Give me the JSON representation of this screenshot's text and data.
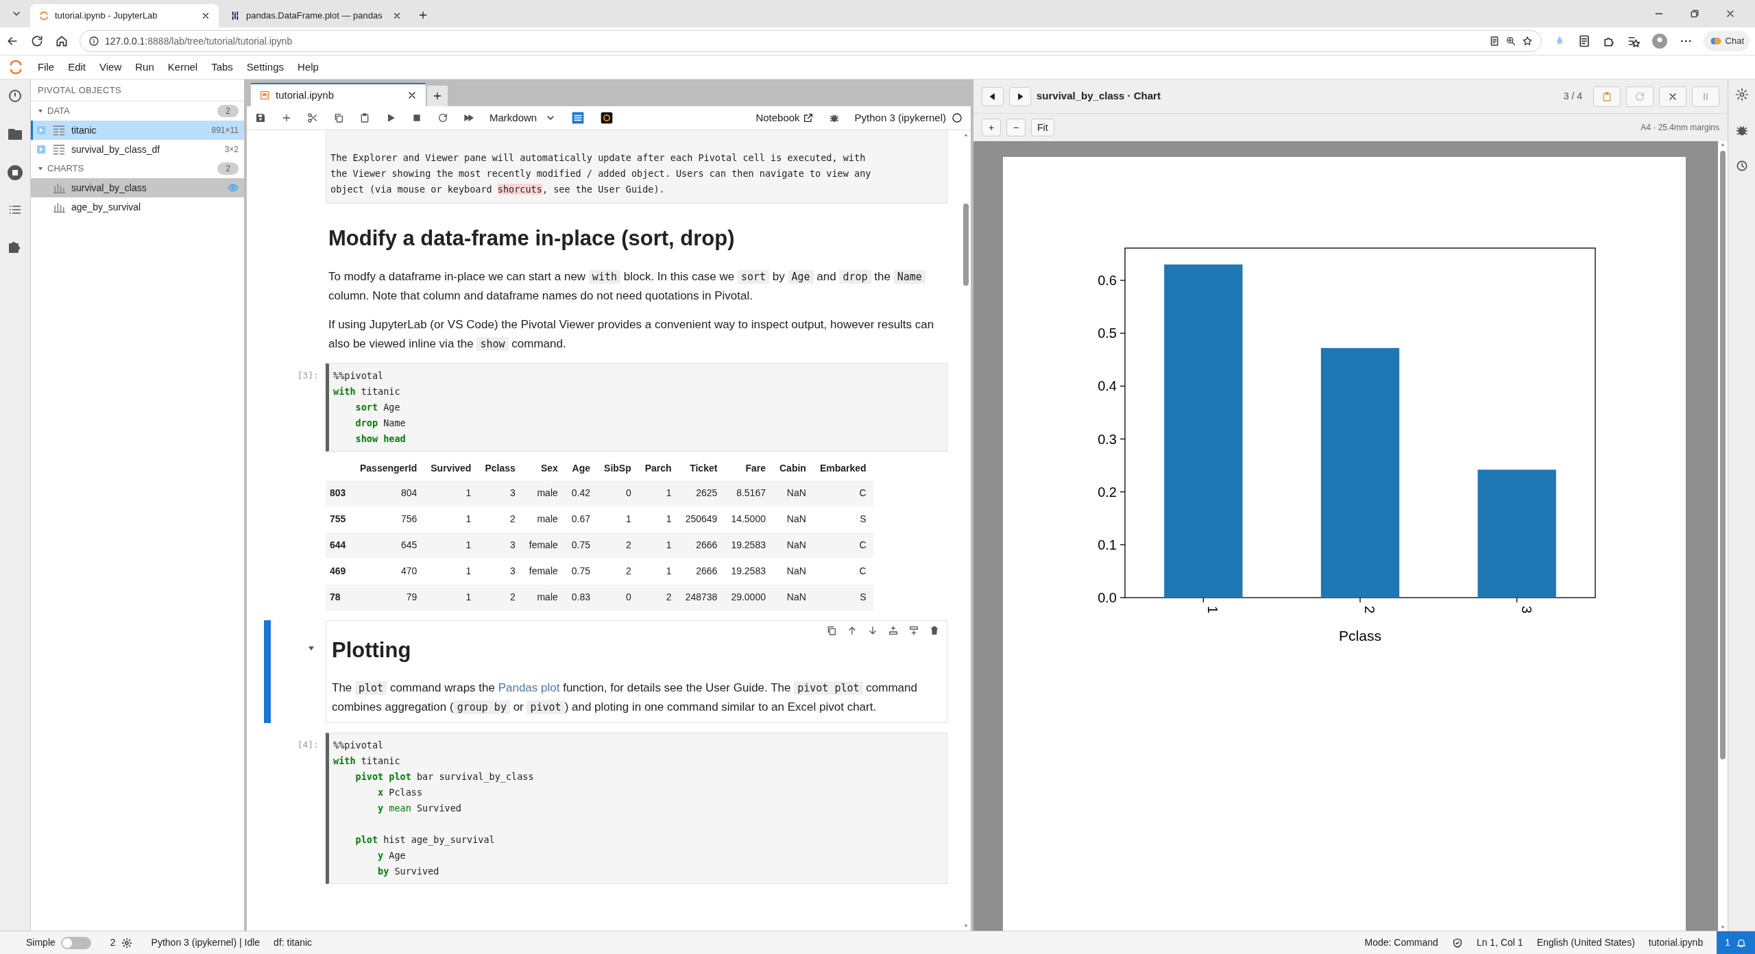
{
  "browser": {
    "tabs": [
      {
        "title": "tutorial.ipynb - JupyterLab",
        "kind": "jupyter",
        "selected": true
      },
      {
        "title": "pandas.DataFrame.plot — pandas",
        "kind": "pandas",
        "selected": false
      }
    ],
    "url_host": "127.0.0.1",
    "url_rest": ":8888/lab/tree/tutorial/tutorial.ipynb",
    "chat_label": "Chat"
  },
  "menu": [
    "File",
    "Edit",
    "View",
    "Run",
    "Kernel",
    "Tabs",
    "Settings",
    "Help"
  ],
  "sidebar": {
    "title": "PIVOTAL OBJECTS",
    "sections": [
      {
        "name": "DATA",
        "count": "2",
        "expanded": true,
        "items": [
          {
            "name": "titanic",
            "kind": "table",
            "size": "891×11",
            "selected": true,
            "viewing": false
          },
          {
            "name": "survival_by_class_df",
            "kind": "table",
            "size": "3×2",
            "selected": false,
            "viewing": false
          }
        ]
      },
      {
        "name": "CHARTS",
        "count": "2",
        "expanded": true,
        "items": [
          {
            "name": "survival_by_class",
            "kind": "chart",
            "selected": false,
            "viewing": true
          },
          {
            "name": "age_by_survival",
            "kind": "chart",
            "selected": false,
            "viewing": false
          }
        ]
      }
    ]
  },
  "notebook": {
    "tab": "tutorial.ipynb",
    "cell_type": "Markdown",
    "notebook_label": "Notebook",
    "kernel": "Python 3 (ipykernel)",
    "cells": [
      {
        "kind": "markdown",
        "selected": false,
        "blocks": [
          {
            "kind": "pre",
            "lines": [
              [
                {
                  "text": "The Explorer and Viewer pane will automatically update after each Pivotal cell is executed, with",
                  "kind": "plain"
                }
              ],
              [
                {
                  "text": "the Viewer showing the most recently modified / added object. Users can then navigate to view any",
                  "kind": "plain"
                }
              ],
              [
                {
                  "text": "object (via mouse or keyboard ",
                  "kind": "plain"
                },
                {
                  "text": "shorcuts",
                  "kind": "highlight"
                },
                {
                  "text": ", see the User Guide).",
                  "kind": "plain"
                }
              ]
            ]
          },
          {
            "kind": "heading",
            "text": "Modify a data-frame in-place (sort, drop)"
          },
          {
            "kind": "paragraph",
            "segments": [
              {
                "text": "To modfy a dataframe in-place we can start a new ",
                "kind": "plain"
              },
              {
                "text": "with",
                "kind": "code"
              },
              {
                "text": " block. In this case we ",
                "kind": "plain"
              },
              {
                "text": "sort",
                "kind": "code"
              },
              {
                "text": " by ",
                "kind": "plain"
              },
              {
                "text": "Age",
                "kind": "code"
              },
              {
                "text": " and ",
                "kind": "plain"
              },
              {
                "text": "drop",
                "kind": "code"
              },
              {
                "text": " the ",
                "kind": "plain"
              },
              {
                "text": "Name",
                "kind": "code"
              },
              {
                "text": " column. Note that column and dataframe names do not need quotations in Pivotal.",
                "kind": "plain"
              }
            ]
          },
          {
            "kind": "paragraph",
            "segments": [
              {
                "text": "If using JupyterLab (or VS Code) the Pivotal Viewer provides a convenient way to inspect output, however results can also be viewed inline via the ",
                "kind": "plain"
              },
              {
                "text": "show",
                "kind": "code"
              },
              {
                "text": " command.",
                "kind": "plain"
              }
            ]
          }
        ]
      },
      {
        "kind": "code",
        "selected": false,
        "prompt": "[3]:",
        "groups": [
          [
            [
              {
                "text": "%%pivotal",
                "kind": "plain"
              }
            ],
            [
              {
                "text": "with",
                "kind": "keyword"
              },
              {
                "text": " titanic",
                "kind": "plain"
              }
            ],
            [
              {
                "text": "    sort",
                "kind": "keyword"
              },
              {
                "text": " Age",
                "kind": "plain"
              }
            ],
            [
              {
                "text": "    drop",
                "kind": "keyword"
              },
              {
                "text": " Name",
                "kind": "plain"
              }
            ],
            [
              {
                "text": "    show head",
                "kind": "keyword"
              }
            ]
          ]
        ],
        "output": {
          "columns": [
            "PassengerId",
            "Survived",
            "Pclass",
            "Sex",
            "Age",
            "SibSp",
            "Parch",
            "Ticket",
            "Fare",
            "Cabin",
            "Embarked"
          ],
          "rows": [
            {
              "index": "803",
              "cells": [
                "804",
                "1",
                "3",
                "male",
                "0.42",
                "0",
                "1",
                "2625",
                "8.5167",
                "NaN",
                "C"
              ]
            },
            {
              "index": "755",
              "cells": [
                "756",
                "1",
                "2",
                "male",
                "0.67",
                "1",
                "1",
                "250649",
                "14.5000",
                "NaN",
                "S"
              ]
            },
            {
              "index": "644",
              "cells": [
                "645",
                "1",
                "3",
                "female",
                "0.75",
                "2",
                "1",
                "2666",
                "19.2583",
                "NaN",
                "C"
              ]
            },
            {
              "index": "469",
              "cells": [
                "470",
                "1",
                "3",
                "female",
                "0.75",
                "2",
                "1",
                "2666",
                "19.2583",
                "NaN",
                "C"
              ]
            },
            {
              "index": "78",
              "cells": [
                "79",
                "1",
                "2",
                "male",
                "0.83",
                "0",
                "2",
                "248738",
                "29.0000",
                "NaN",
                "S"
              ]
            }
          ]
        }
      },
      {
        "kind": "markdown",
        "selected": true,
        "blocks": [
          {
            "kind": "heading",
            "text": "Plotting"
          },
          {
            "kind": "paragraph",
            "segments": [
              {
                "text": "The ",
                "kind": "plain"
              },
              {
                "text": "plot",
                "kind": "code"
              },
              {
                "text": " command wraps the ",
                "kind": "plain"
              },
              {
                "text": "Pandas plot",
                "kind": "link"
              },
              {
                "text": " function, for details see the User Guide. The ",
                "kind": "plain"
              },
              {
                "text": "pivot plot",
                "kind": "code"
              },
              {
                "text": " command combines aggregation (",
                "kind": "plain"
              },
              {
                "text": "group by",
                "kind": "code"
              },
              {
                "text": " or ",
                "kind": "plain"
              },
              {
                "text": "pivot",
                "kind": "code"
              },
              {
                "text": ") and ploting in one command similar to an Excel pivot chart.",
                "kind": "plain"
              }
            ]
          }
        ]
      },
      {
        "kind": "code",
        "selected": false,
        "prompt": "[4]:",
        "groups": [
          [
            [
              {
                "text": "%%pivotal",
                "kind": "plain"
              }
            ],
            [
              {
                "text": "with",
                "kind": "keyword"
              },
              {
                "text": " titanic",
                "kind": "plain"
              }
            ],
            [
              {
                "text": "    pivot plot",
                "kind": "keyword"
              },
              {
                "text": " bar survival_by_class",
                "kind": "plain"
              }
            ],
            [
              {
                "text": "        x",
                "kind": "keyword"
              },
              {
                "text": " Pclass",
                "kind": "plain"
              }
            ],
            [
              {
                "text": "        y",
                "kind": "keyword"
              },
              {
                "text": " mean",
                "kind": "builtin"
              },
              {
                "text": " Survived",
                "kind": "plain"
              }
            ]
          ],
          [
            [
              {
                "text": "    plot",
                "kind": "keyword"
              },
              {
                "text": " hist age_by_survival",
                "kind": "plain"
              }
            ],
            [
              {
                "text": "        y",
                "kind": "keyword"
              },
              {
                "text": " Age",
                "kind": "plain"
              }
            ],
            [
              {
                "text": "        by",
                "kind": "keyword"
              },
              {
                "text": " Survived",
                "kind": "plain"
              }
            ]
          ]
        ]
      }
    ]
  },
  "viewer": {
    "title": "survival_by_class · Chart",
    "counter": "3 / 4",
    "zoom_buttons": [
      "+",
      "−",
      "Fit"
    ],
    "page_info": "A4 · 25.4mm margins",
    "chart_data": {
      "type": "bar",
      "xlabel": "Pclass",
      "categories": [
        "1",
        "2",
        "3"
      ],
      "values": [
        0.63,
        0.472,
        0.242
      ],
      "ylim": [
        0,
        0.661
      ],
      "yticks": [
        {
          "value": 0,
          "label": "0.0"
        },
        {
          "value": 0.1,
          "label": "0.1"
        },
        {
          "value": 0.2,
          "label": "0.2"
        },
        {
          "value": 0.3,
          "label": "0.3"
        },
        {
          "value": 0.4,
          "label": "0.4"
        },
        {
          "value": 0.5,
          "label": "0.5"
        },
        {
          "value": 0.6,
          "label": "0.6"
        }
      ],
      "color": "#1f77b4"
    }
  },
  "status_bar": {
    "simple_mode": {
      "label": "Simple",
      "on": false
    },
    "terminals": "2",
    "kernel_status": "Python 3 (ipykernel) | Idle",
    "dataframe": "df: titanic",
    "mode": "Mode: Command",
    "position": "Ln 1, Col 1",
    "language": "English (United States)",
    "file": "tutorial.ipynb",
    "notifications": "1"
  }
}
